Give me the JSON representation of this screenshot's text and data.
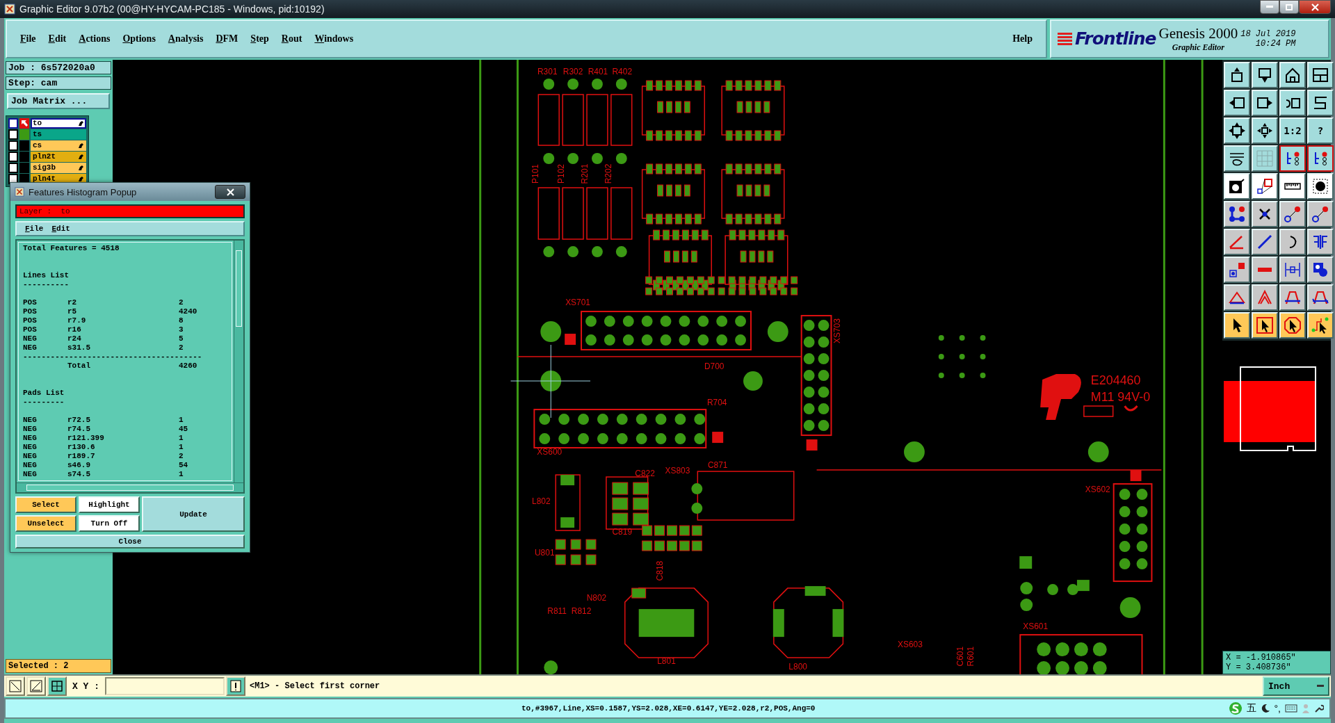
{
  "window": {
    "title": "Graphic Editor 9.07b2 (00@HY-HYCAM-PC185 - Windows, pid:10192)"
  },
  "menu": [
    "File",
    "Edit",
    "Actions",
    "Options",
    "Analysis",
    "DFM",
    "Step",
    "Rout",
    "Windows"
  ],
  "help": "Help",
  "brand": {
    "logo": "Frontline",
    "product": "Genesis 2000",
    "subtitle": "Graphic Editor",
    "date": "18 Jul 2019",
    "time": "10:24 PM"
  },
  "job": {
    "job": "Job : 6s572020a0",
    "step": "Step: cam",
    "matrix_button": "Job Matrix ...",
    "selected": "Selected : 2"
  },
  "layers": [
    {
      "name": "to",
      "selected": true,
      "checked": false,
      "color": "#ffffff",
      "work": true,
      "shown": true,
      "affected": true
    },
    {
      "name": "ts",
      "selected": false,
      "checked": false,
      "color": "#0aa689",
      "work": false,
      "shown": true,
      "affected": false
    },
    {
      "name": "cs",
      "selected": false,
      "checked": false,
      "color": "#ffc858",
      "work": false,
      "shown": false,
      "affected": true
    },
    {
      "name": "pln2t",
      "selected": false,
      "checked": false,
      "color": "#e2ae10",
      "work": false,
      "shown": false,
      "affected": true
    },
    {
      "name": "sig3b",
      "selected": false,
      "checked": false,
      "color": "#ffc858",
      "work": false,
      "shown": false,
      "affected": true
    },
    {
      "name": "pln4t",
      "selected": false,
      "checked": false,
      "color": "#e2ae10",
      "work": false,
      "shown": false,
      "affected": true
    }
  ],
  "popup": {
    "title": "Features Histogram Popup",
    "layer": "Layer :  to",
    "menu": [
      "File",
      "Edit"
    ],
    "total": "Total Features = 4518",
    "sections": [
      {
        "title": "Lines List",
        "rule": "----------",
        "rows": [
          {
            "polarity": "POS",
            "symbol": "r2",
            "count": "2"
          },
          {
            "polarity": "POS",
            "symbol": "r5",
            "count": "4240"
          },
          {
            "polarity": "POS",
            "symbol": "r7.9",
            "count": "8"
          },
          {
            "polarity": "POS",
            "symbol": "r16",
            "count": "3"
          },
          {
            "polarity": "NEG",
            "symbol": "r24",
            "count": "5"
          },
          {
            "polarity": "NEG",
            "symbol": "s31.5",
            "count": "2"
          }
        ],
        "total_rule": "---------------------------------------",
        "total_label": "Total",
        "total": "4260"
      },
      {
        "title": "Pads List",
        "rule": "---------",
        "rows": [
          {
            "polarity": "NEG",
            "symbol": "r72.5",
            "count": "1"
          },
          {
            "polarity": "NEG",
            "symbol": "r74.5",
            "count": "45"
          },
          {
            "polarity": "NEG",
            "symbol": "r121.399",
            "count": "1"
          },
          {
            "polarity": "NEG",
            "symbol": "r130.6",
            "count": "1"
          },
          {
            "polarity": "NEG",
            "symbol": "r189.7",
            "count": "2"
          },
          {
            "polarity": "NEG",
            "symbol": "s46.9",
            "count": "54"
          },
          {
            "polarity": "NEG",
            "symbol": "s74.5",
            "count": "1"
          }
        ]
      }
    ],
    "buttons": [
      {
        "label": "Select",
        "kind": "select"
      },
      {
        "label": "Highlight",
        "kind": "toggle"
      },
      {
        "label": "Unselect",
        "kind": "select"
      },
      {
        "label": "Turn Off",
        "kind": "toggle"
      },
      {
        "label": "Update",
        "kind": "action"
      }
    ],
    "close": "Close"
  },
  "board_labels": [
    "R301",
    "R302",
    "R401",
    "R402",
    "P101",
    "P102",
    "R201",
    "R202",
    "XS701",
    "XS703",
    "XS600",
    "XS602",
    "XS601",
    "XS603",
    "XS803",
    "L802",
    "U801",
    "C871",
    "C819",
    "C818",
    "C822",
    "L801",
    "L800",
    "N802",
    "R811",
    "R812",
    "C601",
    "R601",
    "D700",
    "R704",
    "E204460",
    "M11 94V-0"
  ],
  "toolbar": {
    "scale": "1:2",
    "help": "?"
  },
  "coords": {
    "x": "X = -1.910865\"",
    "y": "Y = 3.408736\""
  },
  "command": {
    "xy_label": "X Y :",
    "prompt": "<M1> - Select first corner",
    "units": "Inch"
  },
  "status": "to,#3967,Line,XS=0.1587,YS=2.028,XE=0.6147,YE=2.028,r2,POS,Ang=0",
  "tray": {
    "input_mode": "五",
    "punct": "°,"
  }
}
